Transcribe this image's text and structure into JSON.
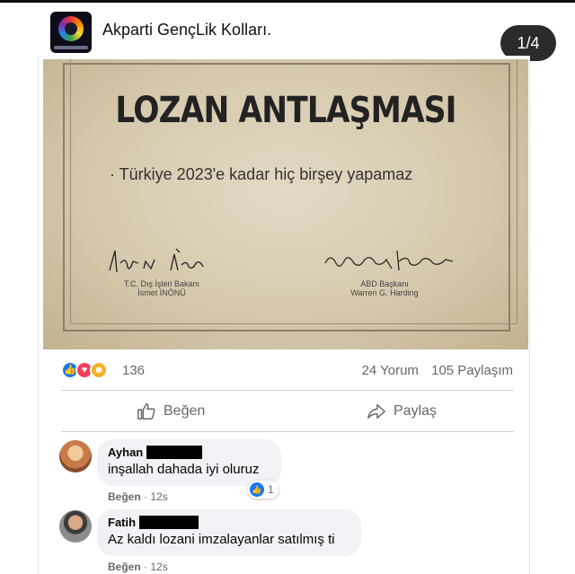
{
  "header": {
    "page_name": "Akparti GençLik Kolları.",
    "counter": "1/4",
    "avatar_icon": "party-logo-icon"
  },
  "post_image": {
    "title": "LOZAN ANTLAŞMASI",
    "clause": "· Türkiye 2023'e kadar hiç birşey yapamaz",
    "signatory_left": {
      "role": "T.C. Dış İşleri Bakanı",
      "name": "İsmet İNÖNÜ"
    },
    "signatory_right": {
      "role": "ABD Başkanı",
      "name": "Warren G. Harding"
    }
  },
  "reactions": {
    "icons": [
      "like-icon",
      "love-icon",
      "care-icon"
    ],
    "count": "136",
    "comments": "24 Yorum",
    "shares": "105 Paylaşım"
  },
  "actions": {
    "like": "Beğen",
    "share": "Paylaş"
  },
  "comments": [
    {
      "author": "Ayhan",
      "text": "inşallah dahada iyi oluruz",
      "reaction_count": "1",
      "like_label": "Beğen",
      "time": "12s"
    },
    {
      "author": "Fatih",
      "text": "Az kaldı lozani imzalayanlar satılmış ti",
      "like_label": "Beğen",
      "time": "12s"
    }
  ],
  "colors": {
    "like_blue": "#1877f2",
    "love_red": "#f33e58",
    "care_yellow": "#f7b125",
    "bubble_bg": "#f0f2f5"
  }
}
